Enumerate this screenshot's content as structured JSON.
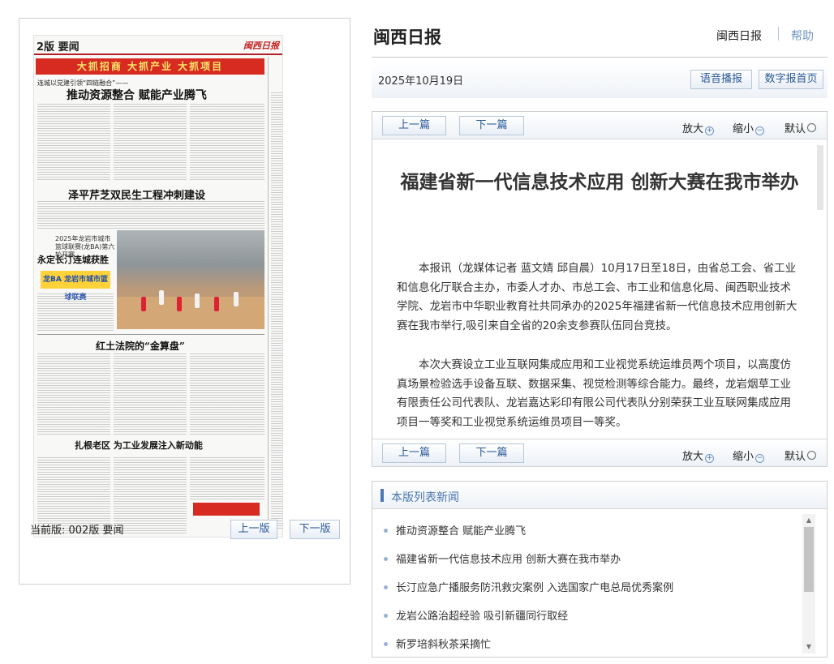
{
  "site": {
    "title": "闽西日报"
  },
  "header": {
    "home_link": "闽西日报",
    "help_link": "帮助"
  },
  "toolbar": {
    "date": "2025年10月19日",
    "audio_button": "语音播报",
    "home_button": "数字报首页"
  },
  "paper": {
    "page_number": "2版 要闻",
    "logo": "闽西日报",
    "banner": "大抓招商 大抓产业 大抓项目",
    "subhead": "连城以党建引领“四链融合”——",
    "headline_1": "推动资源整合 赋能产业腾飞",
    "headline_2": "泽平芹芝双民生工程冲刺建设",
    "headline_3_kicker": "2025年龙岩市城市篮球联赛(龙BA)第六轮开赛",
    "headline_3": "永定长汀连城获胜",
    "league_logo": "龙BA 龙岩市城市篮球联赛",
    "headline_4": "红土法院的“金算盘”",
    "headline_5": "扎根老区 为工业发展注入新动能"
  },
  "edition": {
    "current_label": "当前版: 002版 要闻",
    "prev_page": "上一版",
    "next_page": "下一版"
  },
  "article_nav": {
    "prev": "上一篇",
    "next": "下一篇",
    "zoom_in": "放大",
    "zoom_out": "缩小",
    "zoom_reset": "默认"
  },
  "article": {
    "title": "福建省新一代信息技术应用 创新大赛在我市举办",
    "paragraphs": [
      "本报讯（龙媒体记者 蓝文婧 邱自晨）10月17日至18日，由省总工会、省工业和信息化厅联合主办，市委人才办、市总工会、市工业和信息化局、闽西职业技术学院、龙岩市中华职业教育社共同承办的2025年福建省新一代信息技术应用创新大赛在我市举行,吸引来自全省的20余支参赛队伍同台竞技。",
      "本次大赛设立工业互联网集成应用和工业视觉系统运维员两个项目，以高度仿真场景检验选手设备互联、数据采集、视觉检测等综合能力。最终，龙岩烟草工业有限责任公司代表队、龙岩嘉达彩印有限公司代表队分别荣获工业互联网集成应用项目一等奖和工业视觉系统运维员项目一等奖。"
    ]
  },
  "news_list": {
    "title": "本版列表新闻",
    "items": [
      "推动资源整合 赋能产业腾飞",
      "福建省新一代信息技术应用 创新大赛在我市举办",
      "长汀应急广播服务防汛救灾案例 入选国家广电总局优秀案例",
      "龙岩公路治超经验 吸引新疆同行取经",
      "新罗培斜秋茶采摘忙"
    ]
  },
  "colors": {
    "accent": "#4a76b0",
    "banner_red": "#d72b22",
    "button_text": "#2a5a9a"
  }
}
